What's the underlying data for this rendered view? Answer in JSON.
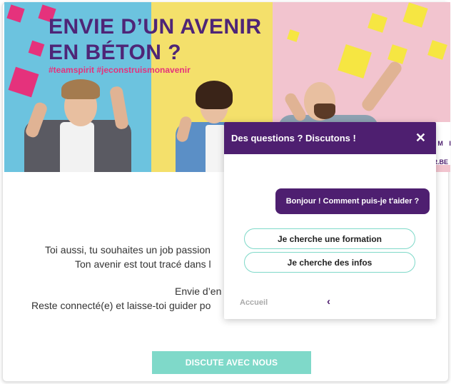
{
  "hero": {
    "headline_line1": "ENVIE D’UN AVENIR",
    "headline_line2": "EN BÉTON ?",
    "hashtags": "#teamspirit #jeconstruismonavenir",
    "sign_text_1": "P M I",
    "sign_text_2": "IR.BE"
  },
  "body": {
    "line1": "Toi aussi, tu souhaites un job passion",
    "line2": "Ton avenir est tout tracé dans l",
    "line3": "Envie d’en",
    "line4": "Reste connecté(e) et laisse-toi guider po",
    "cta_label": "DISCUTE AVEC NOUS"
  },
  "chat": {
    "title": "Des questions ? Discutons !",
    "close_symbol": "✕",
    "bot_message": "Bonjour ! Comment puis-je t'aider ?",
    "choices": [
      "Je cherche une formation",
      "Je cherche des infos"
    ],
    "home_label": "Accueil",
    "back_symbol": "‹"
  },
  "colors": {
    "brand_purple": "#4e1f70",
    "accent_mint": "#7fd9c9",
    "pink": "#e5327c",
    "panel_blue": "#6cc3df",
    "panel_yellow": "#f4e06b",
    "panel_pink": "#f2c4cf"
  }
}
